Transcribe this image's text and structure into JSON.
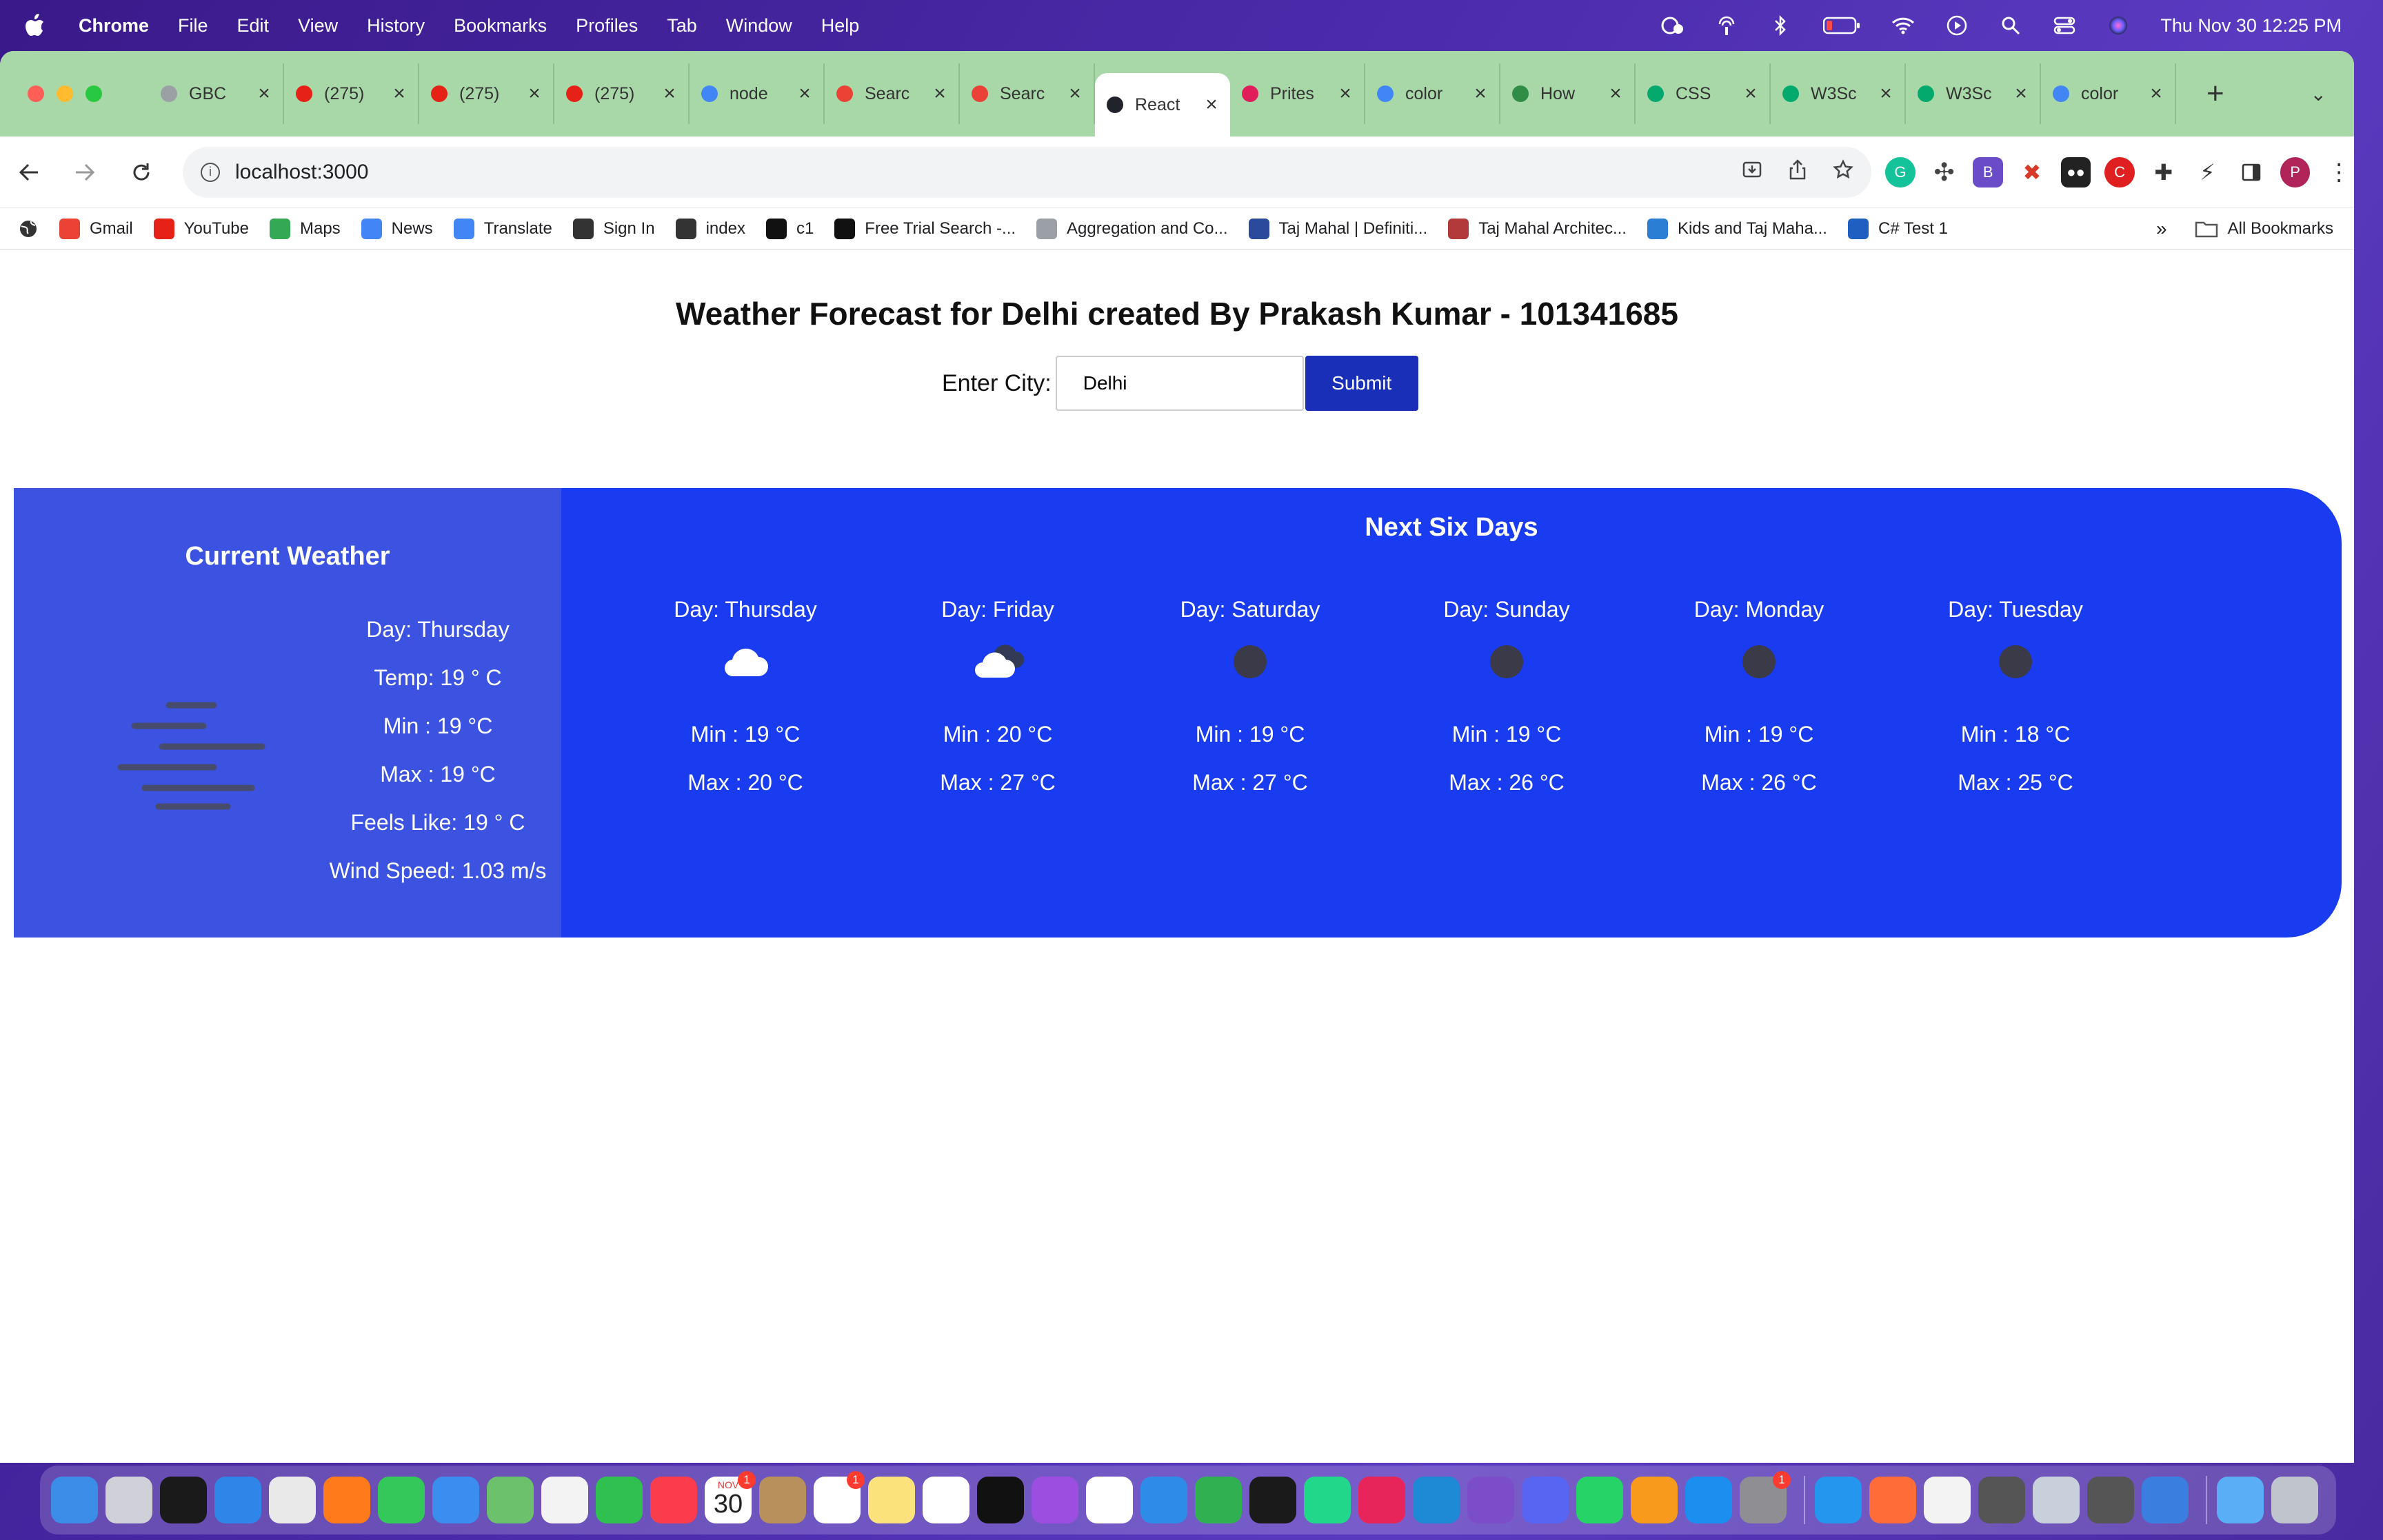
{
  "menubar": {
    "app": "Chrome",
    "items": [
      "File",
      "Edit",
      "View",
      "History",
      "Bookmarks",
      "Profiles",
      "Tab",
      "Window",
      "Help"
    ],
    "clock": "Thu Nov 30  12:25 PM"
  },
  "tabs": [
    {
      "label": "GBC",
      "icon": "globe-icon",
      "color": "#9aa0a6"
    },
    {
      "label": "(275)",
      "icon": "youtube-icon",
      "color": "#e62117"
    },
    {
      "label": "(275)",
      "icon": "youtube-icon",
      "color": "#e62117"
    },
    {
      "label": "(275)",
      "icon": "youtube-icon",
      "color": "#e62117"
    },
    {
      "label": "node",
      "icon": "google-icon",
      "color": "#4285f4"
    },
    {
      "label": "Searc",
      "icon": "gmail-icon",
      "color": "#ea4335"
    },
    {
      "label": "Searc",
      "icon": "gmail-icon",
      "color": "#ea4335"
    },
    {
      "label": "React",
      "icon": "react-icon",
      "color": "#20232a",
      "active": true
    },
    {
      "label": "Prites",
      "icon": "slack-icon",
      "color": "#e01e5a"
    },
    {
      "label": "color",
      "icon": "google-icon",
      "color": "#4285f4"
    },
    {
      "label": "How",
      "icon": "gfg-icon",
      "color": "#2f8d46"
    },
    {
      "label": "CSS",
      "icon": "w3schools-icon",
      "color": "#04aa6d"
    },
    {
      "label": "W3Sc",
      "icon": "w3schools-icon",
      "color": "#04aa6d"
    },
    {
      "label": "W3Sc",
      "icon": "w3schools-icon",
      "color": "#04aa6d"
    },
    {
      "label": "color",
      "icon": "google-icon",
      "color": "#4285f4"
    }
  ],
  "address": {
    "url": "localhost:3000"
  },
  "bookmarks": [
    {
      "label": "Gmail",
      "icon": "gmail-icon",
      "color": "#ea4335"
    },
    {
      "label": "YouTube",
      "icon": "youtube-icon",
      "color": "#e62117"
    },
    {
      "label": "Maps",
      "icon": "maps-icon",
      "color": "#34a853"
    },
    {
      "label": "News",
      "icon": "news-icon",
      "color": "#4285f4"
    },
    {
      "label": "Translate",
      "icon": "translate-icon",
      "color": "#4285f4"
    },
    {
      "label": "Sign In",
      "icon": "globe-icon",
      "color": "#333333"
    },
    {
      "label": "index",
      "icon": "globe-icon",
      "color": "#333333"
    },
    {
      "label": "c1",
      "icon": "star-icon",
      "color": "#111111"
    },
    {
      "label": "Free Trial Search -...",
      "icon": "hi-icon",
      "color": "#111111"
    },
    {
      "label": "Aggregation and Co...",
      "icon": "gear-icon",
      "color": "#9aa0a6"
    },
    {
      "label": "Taj Mahal | Definiti...",
      "icon": "britannica-icon",
      "color": "#2b4a9b"
    },
    {
      "label": "Taj Mahal Architec...",
      "icon": "bookmark-image-icon",
      "color": "#b33a3a"
    },
    {
      "label": "Kids and Taj Maha...",
      "icon": "bookmark-image-icon",
      "color": "#2a7fd4"
    },
    {
      "label": "C# Test 1",
      "icon": "tt-icon",
      "color": "#1f5fbf"
    }
  ],
  "bookmarks_more": "»",
  "all_bookmarks": "All Bookmarks",
  "page": {
    "title": "Weather Forecast for Delhi created By Prakash Kumar - 101341685",
    "form": {
      "label": "Enter City:",
      "value": "Delhi",
      "submit": "Submit"
    },
    "current": {
      "heading": "Current Weather",
      "day": "Day: Thursday",
      "temp": "Temp: 19 ° C",
      "min": "Min : 19 °C",
      "max": "Max : 19 °C",
      "feels": "Feels Like: 19 ° C",
      "wind": "Wind Speed: 1.03 m/s",
      "icon": "fog-icon"
    },
    "forecast": {
      "heading": "Next Six Days",
      "days": [
        {
          "day": "Day: Thursday",
          "min": "Min : 19 °C",
          "max": "Max : 20 °C",
          "icon": "cloud-icon"
        },
        {
          "day": "Day: Friday",
          "min": "Min : 20 °C",
          "max": "Max : 27 °C",
          "icon": "broken-clouds-icon"
        },
        {
          "day": "Day: Saturday",
          "min": "Min : 19 °C",
          "max": "Max : 27 °C",
          "icon": "clear-night-icon"
        },
        {
          "day": "Day: Sunday",
          "min": "Min : 19 °C",
          "max": "Max : 26 °C",
          "icon": "clear-night-icon"
        },
        {
          "day": "Day: Monday",
          "min": "Min : 19 °C",
          "max": "Max : 26 °C",
          "icon": "clear-night-icon"
        },
        {
          "day": "Day: Tuesday",
          "min": "Min : 18 °C",
          "max": "Max : 25 °C",
          "icon": "clear-night-icon"
        }
      ]
    }
  },
  "colors": {
    "current_panel": "#3b53e0",
    "forecast_panel": "#1a3cf0",
    "submit_button": "#1a2fb8",
    "tabstrip": "#a8d8a8"
  },
  "dock": {
    "calendar_month": "NOV",
    "calendar_day": "30",
    "badge_calendar": "1",
    "badge_reminders": "1",
    "badge_settings": "1",
    "apps": [
      {
        "name": "finder-icon",
        "color": "#3b8de8"
      },
      {
        "name": "launchpad-icon",
        "color": "#d0d0d8"
      },
      {
        "name": "terminal-icon",
        "color": "#1a1a1a"
      },
      {
        "name": "safari-icon",
        "color": "#2f86e8"
      },
      {
        "name": "chrome-icon",
        "color": "#e9e9e9"
      },
      {
        "name": "firefox-icon",
        "color": "#ff7a1a"
      },
      {
        "name": "messages-icon",
        "color": "#34c759"
      },
      {
        "name": "mail-icon",
        "color": "#3a8ef0"
      },
      {
        "name": "maps-icon",
        "color": "#6cc26c"
      },
      {
        "name": "photos-icon",
        "color": "#f3f3f3"
      },
      {
        "name": "facetime-icon",
        "color": "#30c050"
      },
      {
        "name": "music-icon",
        "color": "#fa3c4c"
      },
      {
        "name": "calendar-icon",
        "color": "#ffffff"
      },
      {
        "name": "contacts-icon",
        "color": "#b8905c"
      },
      {
        "name": "reminders-icon",
        "color": "#ffffff"
      },
      {
        "name": "notes-icon",
        "color": "#fbe27a"
      },
      {
        "name": "freeform-icon",
        "color": "#ffffff"
      },
      {
        "name": "tv-icon",
        "color": "#111111"
      },
      {
        "name": "podcasts-icon",
        "color": "#9b4ee0"
      },
      {
        "name": "news-icon",
        "color": "#ffffff"
      },
      {
        "name": "keynote-icon",
        "color": "#2e8ce8"
      },
      {
        "name": "numbers-icon",
        "color": "#30b050"
      },
      {
        "name": "webstorm-icon",
        "color": "#1a1a1a"
      },
      {
        "name": "pycharm-icon",
        "color": "#21d789"
      },
      {
        "name": "intellij-icon",
        "color": "#e8255a"
      },
      {
        "name": "vscode-icon",
        "color": "#1e8ad6"
      },
      {
        "name": "visual-studio-icon",
        "color": "#7b4dc8"
      },
      {
        "name": "discord-icon",
        "color": "#5865f2"
      },
      {
        "name": "whatsapp-icon",
        "color": "#25d366"
      },
      {
        "name": "pages-icon",
        "color": "#f89a1c"
      },
      {
        "name": "app-store-icon",
        "color": "#1c8ef0"
      },
      {
        "name": "system-settings-icon",
        "color": "#8e8e93"
      },
      {
        "name": "docker-icon",
        "color": "#2496ed"
      },
      {
        "name": "postman-icon",
        "color": "#ff6c37"
      },
      {
        "name": "font-book-icon",
        "color": "#f3f3f3"
      },
      {
        "name": "automator-icon",
        "color": "#555555"
      },
      {
        "name": "storage-icon",
        "color": "#c8d0dc"
      },
      {
        "name": "calculator-icon",
        "color": "#555555"
      },
      {
        "name": "xcode-icon",
        "color": "#3a7fe0"
      },
      {
        "name": "folder-icon",
        "color": "#5aaef5"
      },
      {
        "name": "trash-icon",
        "color": "#c0c4cc"
      }
    ]
  }
}
